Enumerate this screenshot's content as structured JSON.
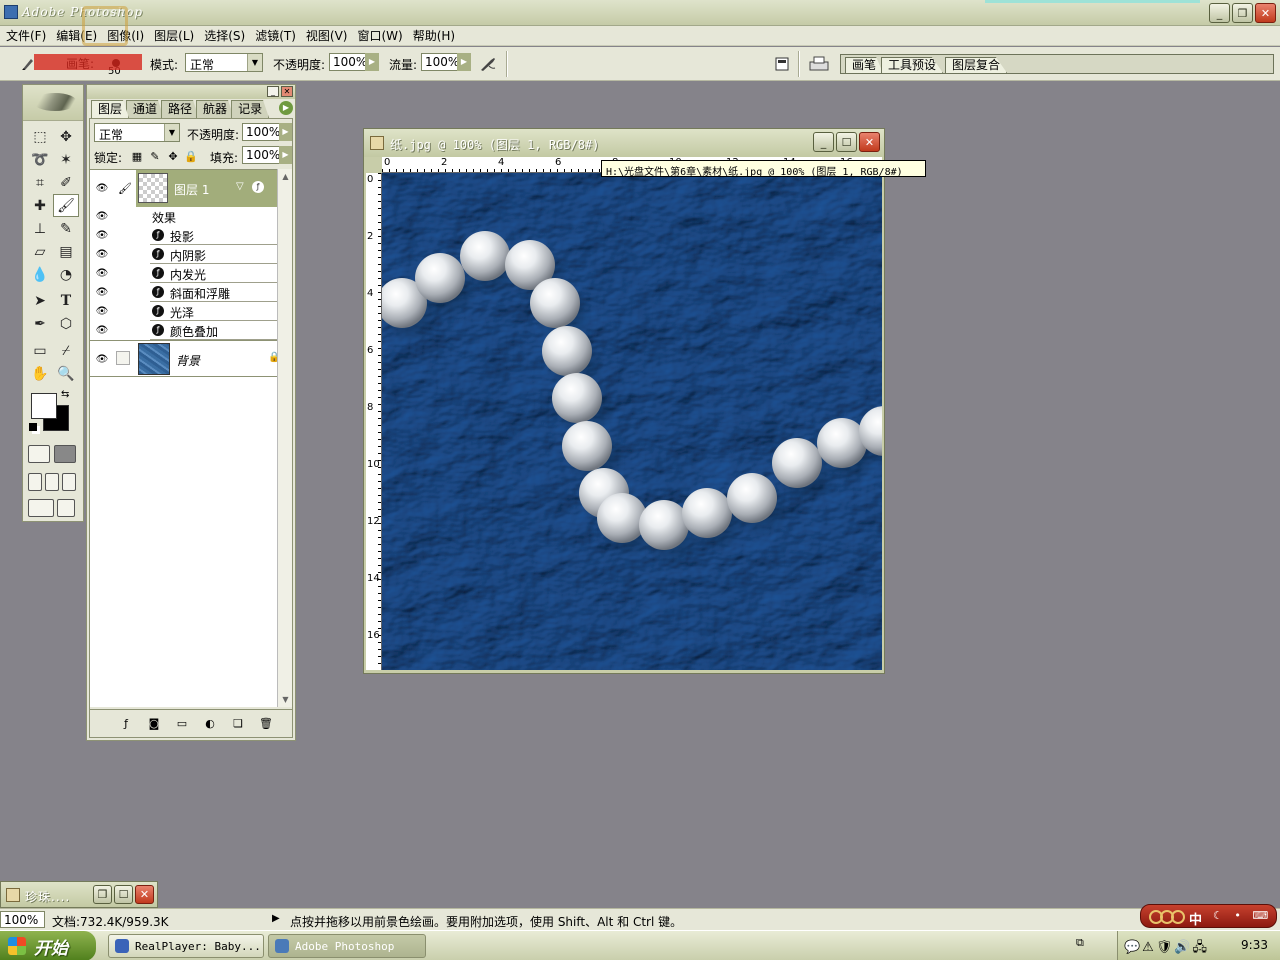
{
  "app": {
    "title": "Adobe Photoshop",
    "window_buttons": {
      "minimize": "_",
      "restore": "❐",
      "close": "✕"
    }
  },
  "menu": [
    "文件(F)",
    "编辑(E)",
    "图像(I)",
    "图层(L)",
    "选择(S)",
    "滤镜(T)",
    "视图(V)",
    "窗口(W)",
    "帮助(H)"
  ],
  "options_bar": {
    "brush_label": "画笔:",
    "brush_size": "50",
    "mode_label": "模式:",
    "mode_value": "正常",
    "opacity_label": "不透明度:",
    "opacity_value": "100%",
    "flow_label": "流量:",
    "flow_value": "100%",
    "well_tabs": [
      "画笔",
      "工具预设",
      "图层复合"
    ]
  },
  "layers_panel": {
    "tabs": [
      "图层",
      "通道",
      "路径",
      "航器",
      "记录"
    ],
    "blend_mode": "正常",
    "opacity_label": "不透明度:",
    "opacity_value": "100%",
    "lock_label": "锁定:",
    "fill_label": "填充:",
    "fill_value": "100%",
    "layer1_name": "图层 1",
    "effects_label": "效果",
    "effects": [
      "投影",
      "内阴影",
      "内发光",
      "斜面和浮雕",
      "光泽",
      "颜色叠加"
    ],
    "background_name": "背景"
  },
  "document": {
    "title": "纸.jpg @ 100% (图层 1, RGB/8#)",
    "tooltip": "H:\\光盘文件\\第6章\\素材\\纸.jpg @ 100% (图层 1, RGB/8#)",
    "hruler_labels": [
      "0",
      "2",
      "4",
      "6",
      "8",
      "10",
      "12",
      "14",
      "16"
    ],
    "vruler_labels": [
      "0",
      "2",
      "4",
      "6",
      "8",
      "10",
      "12",
      "14",
      "16"
    ]
  },
  "minimized_window": {
    "title": "珍珠...."
  },
  "status": {
    "zoom": "100%",
    "doc_size": "文档:732.4K/959.3K",
    "hint": "点按并拖移以用前景色绘画。要用附加选项，使用 Shift、Alt 和 Ctrl 键。"
  },
  "ime": {
    "label": "中"
  },
  "taskbar": {
    "start": "开始",
    "items": [
      {
        "label": "RealPlayer: Baby...",
        "active": false
      },
      {
        "label": "Adobe Photoshop",
        "active": true
      }
    ],
    "clock": "9:33"
  },
  "colors": {
    "ui_bg": "#e6e7d8",
    "workspace": "#85838a",
    "selected_layer": "#a2ad7b",
    "paper_blue": "#3f73a8"
  }
}
